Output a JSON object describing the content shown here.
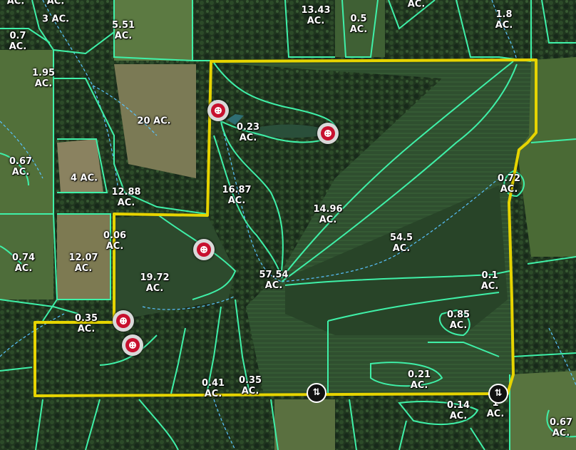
{
  "map": {
    "boundary_color": "#e6d400",
    "parcel_line_color": "#3ff0a8",
    "stream_color": "#59c3ff",
    "icons": {
      "hunting_stand": "crosshair-target-icon",
      "gate": "up-down-arrows-gate-icon"
    },
    "gate_glyph": "⇅",
    "acreage_labels": [
      {
        "value": "",
        "unit": "AC."
      },
      {
        "value": "3",
        "unit": "AC."
      },
      {
        "value": "13.43",
        "unit": "AC."
      },
      {
        "value": "0.5",
        "unit": "AC."
      },
      {
        "value": "",
        "unit": "AC."
      },
      {
        "value": "1.8",
        "unit": "AC."
      },
      {
        "value": "0.7",
        "unit": "AC."
      },
      {
        "value": "5.51",
        "unit": "AC."
      },
      {
        "value": "1.95",
        "unit": "AC."
      },
      {
        "value": "20",
        "unit": "AC."
      },
      {
        "value": "0.23",
        "unit": "AC."
      },
      {
        "value": "0.67",
        "unit": "AC."
      },
      {
        "value": "4",
        "unit": "AC."
      },
      {
        "value": "12.88",
        "unit": "AC."
      },
      {
        "value": "16.87",
        "unit": "AC."
      },
      {
        "value": "14.96",
        "unit": "AC."
      },
      {
        "value": "0.72",
        "unit": "AC."
      },
      {
        "value": "0.06",
        "unit": "AC."
      },
      {
        "value": "54.5",
        "unit": "AC."
      },
      {
        "value": "0.74",
        "unit": "AC."
      },
      {
        "value": "12.07",
        "unit": "AC."
      },
      {
        "value": "19.72",
        "unit": "AC."
      },
      {
        "value": "57.54",
        "unit": "AC."
      },
      {
        "value": "0.1",
        "unit": "AC."
      },
      {
        "value": "0.35",
        "unit": "AC."
      },
      {
        "value": "0.85",
        "unit": "AC."
      },
      {
        "value": "0.41",
        "unit": "AC."
      },
      {
        "value": "0.35",
        "unit": "AC."
      },
      {
        "value": "0.21",
        "unit": "AC."
      },
      {
        "value": "0.14",
        "unit": "AC."
      },
      {
        "value": "1",
        "unit": "AC."
      },
      {
        "value": "0.67",
        "unit": "AC."
      }
    ]
  }
}
